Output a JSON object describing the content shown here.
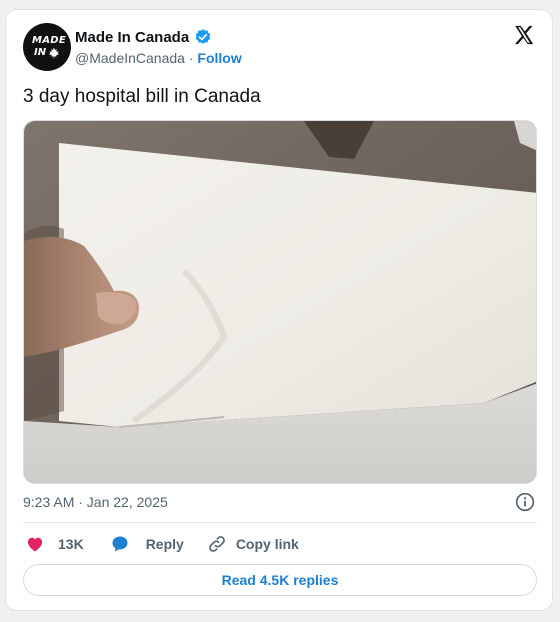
{
  "account": {
    "display_name": "Made In Canada",
    "handle": "@MadeInCanada",
    "separator": "·",
    "follow_label": "Follow",
    "verified": true,
    "avatar_text_line1": "MADE",
    "avatar_text_line2": "IN"
  },
  "tweet": {
    "text": "3 day hospital bill in Canada",
    "image_subject": "folded blank white paper held in a hand",
    "timestamp": "9:23 AM · Jan 22, 2025"
  },
  "actions": {
    "likes": "13K",
    "reply_label": "Reply",
    "copy_link_label": "Copy link",
    "read_replies_label": "Read 4.5K replies"
  },
  "colors": {
    "accent": "#1d7fd1",
    "like_pink": "#e0245e",
    "verified_blue": "#1d9bf0",
    "text_primary": "#0f1419",
    "text_secondary": "#536471"
  },
  "icons": [
    "verified-badge-icon",
    "x-logo-icon",
    "info-icon",
    "heart-icon",
    "reply-bubble-icon",
    "link-icon",
    "maple-leaf-icon"
  ]
}
